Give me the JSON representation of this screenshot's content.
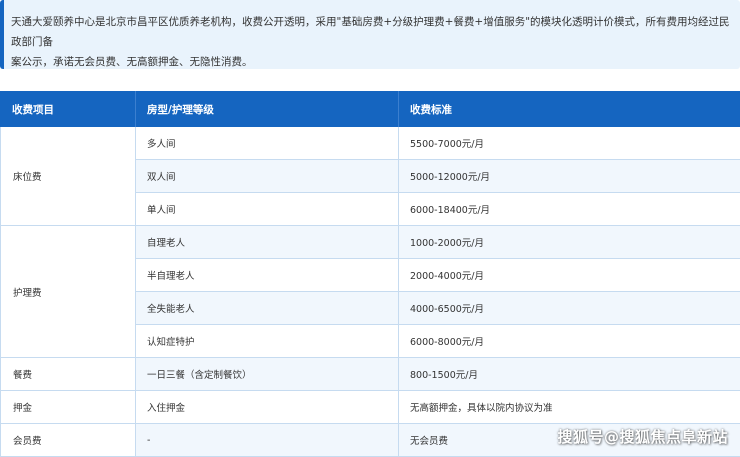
{
  "notice": {
    "line1": "天通大爱颐养中心是北京市昌平区优质养老机构，收费公开透明，采用\"基础房费+分级护理费+餐费+增值服务\"的模块化透明计价模式，所有费用均经过民政部门备",
    "line2": "案公示，承诺无会员费、无高额押金、无隐性消费。"
  },
  "table": {
    "headers": [
      "收费项目",
      "房型/护理等级",
      "收费标准"
    ],
    "groups": [
      {
        "category": "床位费",
        "rows": [
          {
            "level": "多人间",
            "price": "5500-7000元/月"
          },
          {
            "level": "双人间",
            "price": "5000-12000元/月"
          },
          {
            "level": "单人间",
            "price": "6000-18400元/月"
          }
        ]
      },
      {
        "category": "护理费",
        "rows": [
          {
            "level": "自理老人",
            "price": "1000-2000元/月"
          },
          {
            "level": "半自理老人",
            "price": "2000-4000元/月"
          },
          {
            "level": "全失能老人",
            "price": "4000-6500元/月"
          },
          {
            "level": "认知症特护",
            "price": "6000-8000元/月"
          }
        ]
      },
      {
        "category": "餐费",
        "rows": [
          {
            "level": "一日三餐（含定制餐饮）",
            "price": "800-1500元/月"
          }
        ]
      },
      {
        "category": "押金",
        "rows": [
          {
            "level": "入住押金",
            "price": "无高额押金，具体以院内协议为准"
          }
        ]
      },
      {
        "category": "会员费",
        "rows": [
          {
            "level": "-",
            "price": "无会员费"
          }
        ]
      }
    ]
  },
  "watermark": "搜狐号@搜狐焦点阜新站",
  "colors": {
    "header_bg": "#1565c0",
    "notice_bg": "#e9f3fc",
    "accent_border": "#1565c0",
    "grid_line": "#c6dbf0"
  }
}
